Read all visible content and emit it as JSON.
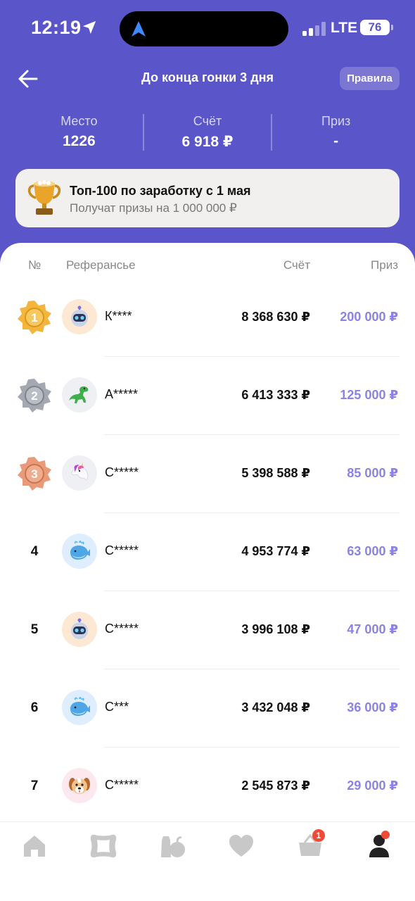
{
  "status_bar": {
    "time": "12:19",
    "network": "LTE",
    "battery": "76"
  },
  "header": {
    "title": "До конца гонки 3 дня",
    "rules_label": "Правила"
  },
  "stats": [
    {
      "label": "Место",
      "value": "1226"
    },
    {
      "label": "Счёт",
      "value": "6 918 ₽"
    },
    {
      "label": "Приз",
      "value": "-"
    }
  ],
  "banner": {
    "title": "Топ-100 по заработку с 1 мая",
    "subtitle": "Получат призы на 1 000 000 ₽",
    "icon": "trophy-icon"
  },
  "table": {
    "headers": {
      "rank": "№",
      "name": "Реферансье",
      "score": "Счёт",
      "prize": "Приз"
    },
    "rows": [
      {
        "rank": "1",
        "medal": "gold",
        "avatar": "robot",
        "name": "К****",
        "score": "8 368 630 ₽",
        "prize": "200 000 ₽"
      },
      {
        "rank": "2",
        "medal": "silver",
        "avatar": "dinosaur",
        "name": "А*****",
        "score": "6 413 333 ₽",
        "prize": "125 000 ₽"
      },
      {
        "rank": "3",
        "medal": "bronze",
        "avatar": "unicorn",
        "name": "С*****",
        "score": "5 398 588 ₽",
        "prize": "85 000 ₽"
      },
      {
        "rank": "4",
        "medal": null,
        "avatar": "whale",
        "name": "С*****",
        "score": "4 953 774 ₽",
        "prize": "63 000 ₽"
      },
      {
        "rank": "5",
        "medal": null,
        "avatar": "robot",
        "name": "С*****",
        "score": "3 996 108 ₽",
        "prize": "47 000 ₽"
      },
      {
        "rank": "6",
        "medal": null,
        "avatar": "whale",
        "name": "С***",
        "score": "3 432 048 ₽",
        "prize": "36 000 ₽"
      },
      {
        "rank": "7",
        "medal": null,
        "avatar": "dog",
        "name": "С*****",
        "score": "2 545 873 ₽",
        "prize": "29 000 ₽"
      }
    ]
  },
  "tabbar": {
    "tabs": [
      "home-icon",
      "catalog-icon",
      "products-icon",
      "favorites-icon",
      "cart-icon",
      "profile-icon"
    ],
    "cart_badge": "1"
  },
  "colors": {
    "brand": "#5a55c9",
    "prize": "#8a83e3",
    "badge": "#ee4a36"
  }
}
